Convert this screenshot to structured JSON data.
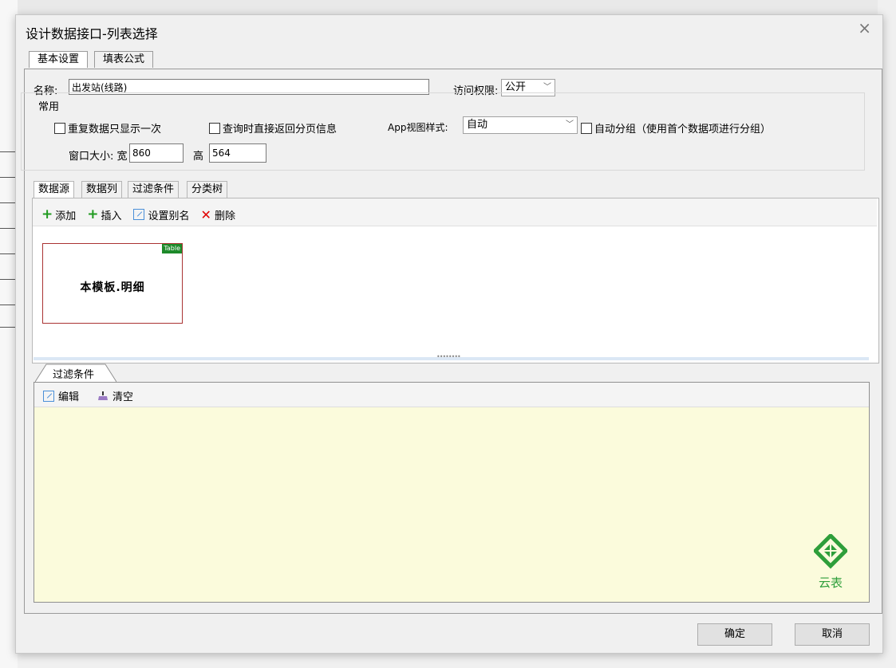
{
  "dialog": {
    "title": "设计数据接口-列表选择",
    "close_glyph": "×"
  },
  "main_tabs": [
    {
      "label": "基本设置",
      "active": true
    },
    {
      "label": "填表公式",
      "active": false
    }
  ],
  "basic": {
    "name_label": "名称:",
    "name_value": "出发站(线路)",
    "access_label": "访问权限:",
    "access_value": "公开"
  },
  "common": {
    "group_label": "常用",
    "show_once_label": "重复数据只显示一次",
    "return_page_label": "查询时直接返回分页信息",
    "app_style_label": "App视图样式:",
    "app_style_value": "自动",
    "auto_group_label": "自动分组（使用首个数据项进行分组）",
    "window_size_label": "窗口大小: 宽",
    "width_value": "860",
    "height_label": "高",
    "height_value": "564"
  },
  "sub_tabs": [
    {
      "label": "数据源",
      "active": true
    },
    {
      "label": "数据列",
      "active": false
    },
    {
      "label": "过滤条件",
      "active": false
    },
    {
      "label": "分类树",
      "active": false
    }
  ],
  "ds_toolbar": {
    "add": "添加",
    "insert": "插入",
    "alias": "设置别名",
    "delete": "删除"
  },
  "table_card": {
    "badge": "Table",
    "label": "本模板.明细"
  },
  "filter": {
    "tab_label": "过滤条件",
    "edit": "编辑",
    "clear": "清空"
  },
  "logo": {
    "text": "云表",
    "color": "#2e9e3a"
  },
  "footer": {
    "ok": "确定",
    "cancel": "取消"
  },
  "colors": {
    "filter_bg": "#fbfbdc",
    "add_green": "#1f9a1f",
    "delete_red": "#e00000"
  }
}
